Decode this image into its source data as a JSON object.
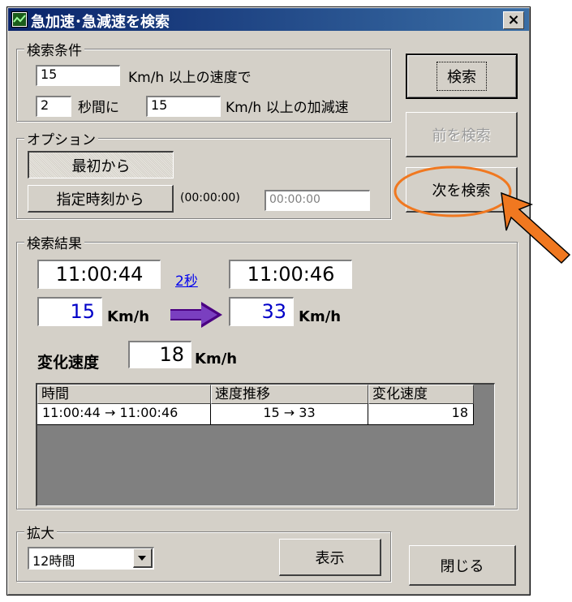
{
  "window": {
    "title": "急加速･急減速を検索",
    "close_label": "×"
  },
  "criteria": {
    "legend": "検索条件",
    "speed_value": "15",
    "speed_label": "Km/h 以上の速度で",
    "seconds_value": "2",
    "seconds_label": "秒間に",
    "accel_value": "15",
    "accel_label": "Km/h 以上の加減速"
  },
  "options": {
    "legend": "オプション",
    "from_start_label": "最初から",
    "from_time_label": "指定時刻から",
    "time_format": "(00:00:00)",
    "time_value": "00:00:00"
  },
  "buttons": {
    "search": "検索",
    "prev": "前を検索",
    "next": "次を検索",
    "show": "表示",
    "close": "閉じる"
  },
  "results": {
    "legend": "検索結果",
    "start_time": "11:00:44",
    "end_time": "11:00:46",
    "duration_link": "2秒",
    "start_speed": "15",
    "end_speed": "33",
    "speed_unit": "Km/h",
    "change_label": "変化速度",
    "change_value": "18",
    "change_unit": "Km/h",
    "table": {
      "headers": [
        "時間",
        "速度推移",
        "変化速度"
      ],
      "rows": [
        [
          "11:00:44 → 11:00:46",
          "15 → 33",
          "18"
        ]
      ]
    }
  },
  "zoom": {
    "legend": "拡大",
    "selected": "12時間"
  },
  "colors": {
    "annotation": "#f07820",
    "titlebar": "#0a246a",
    "speed_text": "#0000c8",
    "arrow": "#4b0082"
  }
}
